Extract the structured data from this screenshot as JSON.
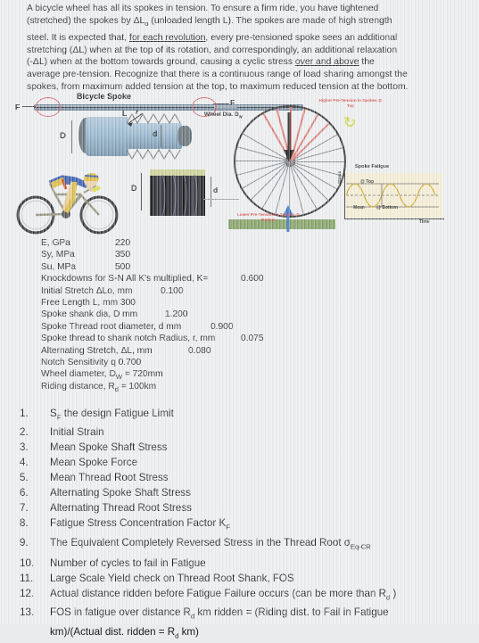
{
  "intro": {
    "l1": "A bicycle wheel has all its spokes in tension. To ensure a firm ride, you have tightened",
    "l2a": "(stretched) the spokes by ",
    "l2b": "L",
    "l2c": "o",
    "l2d": " (unloaded length L). The spokes are made of high strength",
    "l3a": "steel. It is expected that, ",
    "l3u": "for each revolution",
    "l3b": ", every pre-tensioned spoke sees  an additional",
    "l4": "stretching (ΔL) when at the top of its rotation, and correspondingly,  an additional  relaxation",
    "l5a": "(-ΔL) when at the bottom towards ground, causing a cyclic stress ",
    "l5u": "over and above",
    "l5b": " the",
    "l6": "average pre-tension. Recognize that there is a continuous range of load sharing amongst the",
    "l7": "spokes, from maximum added tension at the top, to maximum reduced tension at the bottom."
  },
  "figure": {
    "title": "Bicycle Spoke",
    "force_left": "F",
    "force_right": "F",
    "length_label": "L",
    "shank_dia_label": "D",
    "thread_dia_label": "d",
    "notch_radius_label": "r",
    "wheel_dia_label": "Wheel Dia. D",
    "wheel_dia_sub": "w",
    "photo_dia_label": "D",
    "photo_thread_label": "d",
    "top_note": "Higher Pre-Tension in Spokes @ Top",
    "bottom_note": "Lower Pre-Tension in Spokes @ Bottom",
    "rotation_arrow": "↻"
  },
  "fatigue_chart": {
    "title": "Spoke Fatigue",
    "ylabel": "Stress",
    "xlabel": "Time",
    "label_top": "@ Top",
    "label_mean": "Mean",
    "label_bottom": "@ Bottom"
  },
  "colors": {
    "page_bg": "#e9ebed",
    "accent_red": "#d4453f",
    "spoke_steel": "#8fb0c8",
    "panel_cream": "#f2ead0",
    "ground_green": "#7d9b5e",
    "arrow_blue": "#2f6fc0"
  },
  "data_rows": [
    {
      "label": "E, GPa",
      "value": "220",
      "value_x": 83
    },
    {
      "label": "Sy, MPa",
      "value": "350",
      "value_x": 83
    },
    {
      "label": "Su, MPa",
      "value": "500",
      "value_x": 83
    },
    {
      "label": "Knockdowns for S-N All K's multiplied, K=",
      "value": "0.600",
      "value_x": 224
    },
    {
      "label": "Initial Stretch ΔLo, mm",
      "value": "0.100",
      "value_x": 134
    },
    {
      "label": "Free Length L, mm  300",
      "value": "",
      "value_x": 0
    },
    {
      "label": "Spoke shank dia, D mm",
      "value": "1.200",
      "value_x": 139
    },
    {
      "label": "Spoke Thread root diameter, d mm",
      "value": "0.900",
      "value_x": 190
    },
    {
      "label": "Spoke thread to shank notch Radius, r, mm",
      "value": "0.075",
      "value_x": 224
    },
    {
      "label": "Alternating Stretch, ΔL, mm",
      "value": "0.080",
      "value_x": 165
    },
    {
      "label": "Notch Sensitivity q  0.700",
      "value": "",
      "value_x": 0
    },
    {
      "label": "Wheel diameter, Dᵥw = 720mm",
      "value": "",
      "value_x": 0
    },
    {
      "label": "Riding distance, Rₔ = 100km",
      "value": "",
      "value_x": 0
    }
  ],
  "data_rows_rich": {
    "wheel_diameter": {
      "pre": "Wheel diameter, D",
      "sub": "W",
      "post": " = 720mm"
    },
    "riding_distance": {
      "pre": "Riding distance, R",
      "sub": "d",
      "post": " = 100km"
    },
    "initial_stretch": {
      "pre": "Initial Stretch ΔLo, mm",
      "value": "0.100"
    }
  },
  "questions": [
    {
      "n": "1.",
      "pre": "S",
      "sub": "F",
      "post": " the design Fatigue Limit"
    },
    {
      "n": "2.",
      "pre": "Initial Strain",
      "sub": "",
      "post": ""
    },
    {
      "n": "3.",
      "pre": "Mean Spoke Shaft Stress",
      "sub": "",
      "post": ""
    },
    {
      "n": "4.",
      "pre": "Mean Spoke Force",
      "sub": "",
      "post": ""
    },
    {
      "n": "5.",
      "pre": "Mean Thread Root Stress",
      "sub": "",
      "post": ""
    },
    {
      "n": "6.",
      "pre": "Alternating  Spoke Shaft Stress",
      "sub": "",
      "post": ""
    },
    {
      "n": "7.",
      "pre": "Alternating  Thread Root Stress",
      "sub": "",
      "post": ""
    },
    {
      "n": "8.",
      "pre": "Fatigue Stress Concentration Factor K",
      "sub": "F",
      "post": ""
    },
    {
      "n": "9.",
      "pre": "The Equivalent Completely Reversed Stress in the Thread Root σ",
      "sub": "Eq-CR",
      "post": ""
    },
    {
      "n": "10.",
      "pre": "Number of cycles to fail in Fatigue",
      "sub": "",
      "post": ""
    },
    {
      "n": "11.",
      "pre": "Large Scale Yield check on Thread Root Shank, FOS",
      "sub": "",
      "post": ""
    },
    {
      "n": "12.",
      "pre": "Actual distance ridden before Fatigue Failure occurs (can be more than R",
      "sub": "d",
      "post": " )"
    }
  ],
  "question13": {
    "n": "13.",
    "p1": "FOS in fatigue over distance R",
    "s1": "d",
    "p2": " km ridden =  (Riding dist. to Fail in Fatigue",
    "p3": "km)/(Actual dist. ridden = R",
    "s3": "d",
    "p4": " km)"
  }
}
